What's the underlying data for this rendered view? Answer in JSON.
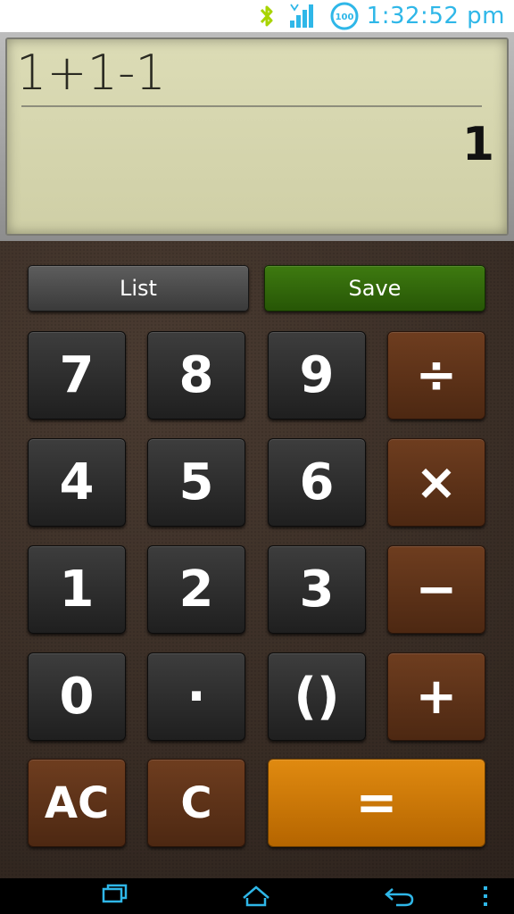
{
  "status": {
    "time": "1:32:52 pm",
    "icons": [
      "bluetooth-icon",
      "signal-icon",
      "battery-icon"
    ],
    "battery_level": "100"
  },
  "display": {
    "expression": "1+1-1",
    "result": "1"
  },
  "actions": {
    "list_label": "List",
    "save_label": "Save"
  },
  "keys": {
    "seven": "7",
    "eight": "8",
    "nine": "9",
    "divide": "÷",
    "four": "4",
    "five": "5",
    "six": "6",
    "multiply": "×",
    "one": "1",
    "two": "2",
    "three": "3",
    "minus": "−",
    "zero": "0",
    "dot": "·",
    "parens": "()",
    "plus": "+",
    "all_clear": "AC",
    "clear": "C",
    "equals": "="
  },
  "nav": {
    "icons": [
      "recent-apps-icon",
      "home-icon",
      "back-icon",
      "menu-icon"
    ]
  },
  "colors": {
    "accent": "#2fb7e8",
    "operator": "#5a3018",
    "equals": "#d07800",
    "save": "#336a0b"
  }
}
